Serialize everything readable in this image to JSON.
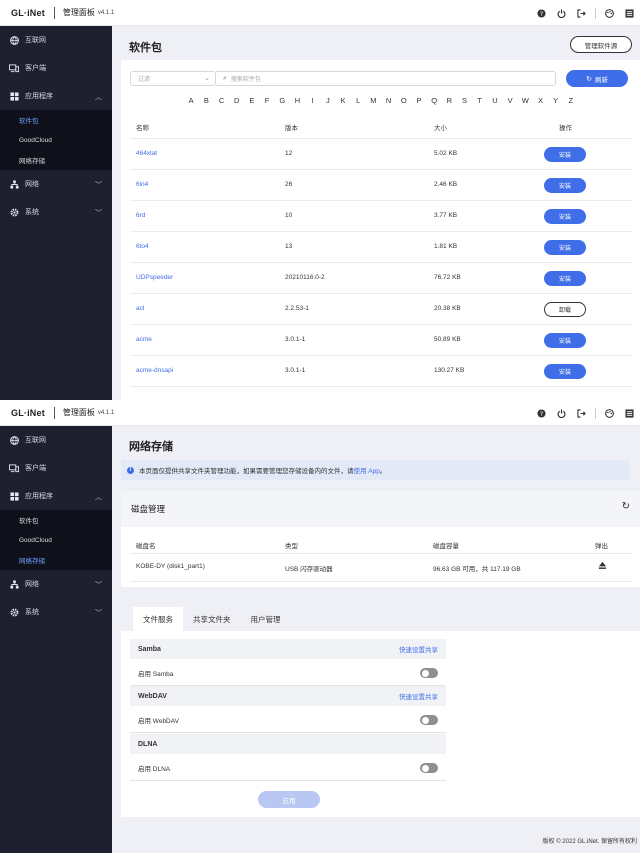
{
  "header": {
    "brand": "GL·iNet",
    "title": "管理面板",
    "version": "v4.1.1"
  },
  "icons": [
    "help-icon",
    "power-icon",
    "logout-icon",
    "theme-icon",
    "menu-icon"
  ],
  "sidebar": {
    "internet": "互联网",
    "clients": "客户端",
    "applications": "应用程序",
    "sub": {
      "packages": "软件包",
      "goodcloud": "GoodCloud",
      "storage": "网络存储"
    },
    "network": "网络",
    "system": "系统"
  },
  "packages": {
    "title": "软件包",
    "manage_sources": "管理软件源",
    "filter_placeholder": "过滤",
    "search_placeholder": "搜索软件包",
    "refresh": "刷新",
    "letters": [
      "A",
      "B",
      "C",
      "D",
      "E",
      "F",
      "G",
      "H",
      "I",
      "J",
      "K",
      "L",
      "M",
      "N",
      "O",
      "P",
      "Q",
      "R",
      "S",
      "T",
      "U",
      "V",
      "W",
      "X",
      "Y",
      "Z"
    ],
    "columns": {
      "name": "名称",
      "version": "版本",
      "size": "大小",
      "action": "操作"
    },
    "rows": [
      {
        "name": "464xlat",
        "version": "12",
        "size": "5.02 KB",
        "action": "安装",
        "installed": false
      },
      {
        "name": "6in4",
        "version": "26",
        "size": "2.46 KB",
        "action": "安装",
        "installed": false
      },
      {
        "name": "6rd",
        "version": "10",
        "size": "3.77 KB",
        "action": "安装",
        "installed": false
      },
      {
        "name": "6to4",
        "version": "13",
        "size": "1.81 KB",
        "action": "安装",
        "installed": false
      },
      {
        "name": "UDPspeeder",
        "version": "20210116.0-2",
        "size": "76.72 KB",
        "action": "安装",
        "installed": false
      },
      {
        "name": "acl",
        "version": "2.2.53-1",
        "size": "20.38 KB",
        "action": "卸载",
        "installed": true
      },
      {
        "name": "acme",
        "version": "3.0.1-1",
        "size": "50.89 KB",
        "action": "安装",
        "installed": false
      },
      {
        "name": "acme-dnsapi",
        "version": "3.0.1-1",
        "size": "130.27 KB",
        "action": "安装",
        "installed": false
      }
    ]
  },
  "storage": {
    "title": "网络存储",
    "info_text": "本页面仅提供共享文件夹管理功能，如果需要管理您存储设备内的文件，请",
    "info_link": "使用 App",
    "info_end": "。",
    "disk_title": "磁盘管理",
    "disk_columns": {
      "name": "磁盘名",
      "type": "类型",
      "capacity": "磁盘容量",
      "eject": "弹出"
    },
    "disk": {
      "name": "KOBE-DY (disk1_part1)",
      "type": "USB 闪存驱动器",
      "capacity": "96.63 GB 可用，共 117.19 GB"
    },
    "tabs": [
      "文件服务",
      "共享文件夹",
      "用户管理"
    ],
    "samba": {
      "title": "Samba",
      "quick": "快速设置共享",
      "enable": "启用 Samba",
      "enabled": false
    },
    "webdav": {
      "title": "WebDAV",
      "quick": "快速设置共享",
      "enable": "启用 WebDAV",
      "enabled": false
    },
    "dlna": {
      "title": "DLNA",
      "enable": "启用 DLNA",
      "enabled": false
    },
    "apply": "应用"
  },
  "footer": "版权 © 2022 GL.iNet. 保留所有权利",
  "colors": {
    "accent": "#3f6ee8",
    "sidebar": "#1e2030",
    "background": "#eff0f5"
  }
}
